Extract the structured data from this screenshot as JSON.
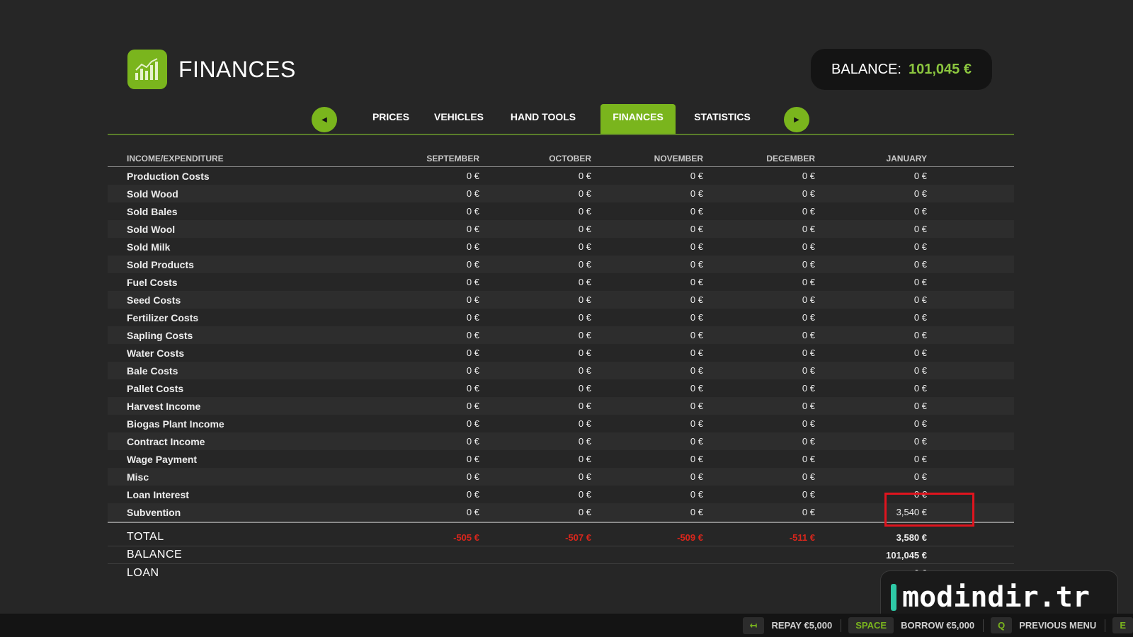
{
  "header": {
    "title": "FINANCES",
    "balance_label": "BALANCE:",
    "balance_value": "101,045 €"
  },
  "nav": {
    "prev_icon": "triangle-left",
    "next_icon": "triangle-right",
    "tabs": [
      {
        "label": "PRICES"
      },
      {
        "label": "VEHICLES"
      },
      {
        "label": "HAND TOOLS"
      },
      {
        "label": "FINANCES",
        "active": true
      },
      {
        "label": "STATISTICS"
      }
    ]
  },
  "table": {
    "headers": [
      "INCOME/EXPENDITURE",
      "SEPTEMBER",
      "OCTOBER",
      "NOVEMBER",
      "DECEMBER",
      "JANUARY"
    ],
    "rows": [
      {
        "name": "Production Costs",
        "values": [
          "0 €",
          "0 €",
          "0 €",
          "0 €",
          "0 €"
        ]
      },
      {
        "name": "Sold Wood",
        "values": [
          "0 €",
          "0 €",
          "0 €",
          "0 €",
          "0 €"
        ]
      },
      {
        "name": "Sold Bales",
        "values": [
          "0 €",
          "0 €",
          "0 €",
          "0 €",
          "0 €"
        ]
      },
      {
        "name": "Sold Wool",
        "values": [
          "0 €",
          "0 €",
          "0 €",
          "0 €",
          "0 €"
        ]
      },
      {
        "name": "Sold Milk",
        "values": [
          "0 €",
          "0 €",
          "0 €",
          "0 €",
          "0 €"
        ]
      },
      {
        "name": "Sold Products",
        "values": [
          "0 €",
          "0 €",
          "0 €",
          "0 €",
          "0 €"
        ]
      },
      {
        "name": "Fuel Costs",
        "values": [
          "0 €",
          "0 €",
          "0 €",
          "0 €",
          "0 €"
        ]
      },
      {
        "name": "Seed Costs",
        "values": [
          "0 €",
          "0 €",
          "0 €",
          "0 €",
          "0 €"
        ]
      },
      {
        "name": "Fertilizer Costs",
        "values": [
          "0 €",
          "0 €",
          "0 €",
          "0 €",
          "0 €"
        ]
      },
      {
        "name": "Sapling Costs",
        "values": [
          "0 €",
          "0 €",
          "0 €",
          "0 €",
          "0 €"
        ]
      },
      {
        "name": "Water Costs",
        "values": [
          "0 €",
          "0 €",
          "0 €",
          "0 €",
          "0 €"
        ]
      },
      {
        "name": "Bale Costs",
        "values": [
          "0 €",
          "0 €",
          "0 €",
          "0 €",
          "0 €"
        ]
      },
      {
        "name": "Pallet Costs",
        "values": [
          "0 €",
          "0 €",
          "0 €",
          "0 €",
          "0 €"
        ]
      },
      {
        "name": "Harvest Income",
        "values": [
          "0 €",
          "0 €",
          "0 €",
          "0 €",
          "0 €"
        ]
      },
      {
        "name": "Biogas Plant Income",
        "values": [
          "0 €",
          "0 €",
          "0 €",
          "0 €",
          "0 €"
        ]
      },
      {
        "name": "Contract Income",
        "values": [
          "0 €",
          "0 €",
          "0 €",
          "0 €",
          "0 €"
        ]
      },
      {
        "name": "Wage Payment",
        "values": [
          "0 €",
          "0 €",
          "0 €",
          "0 €",
          "0 €"
        ]
      },
      {
        "name": "Misc",
        "values": [
          "0 €",
          "0 €",
          "0 €",
          "0 €",
          "0 €"
        ]
      },
      {
        "name": "Loan Interest",
        "values": [
          "0 €",
          "0 €",
          "0 €",
          "0 €",
          "0 €"
        ]
      },
      {
        "name": "Subvention",
        "values": [
          "0 €",
          "0 €",
          "0 €",
          "0 €",
          "3,540 €"
        ]
      }
    ],
    "total": {
      "name": "TOTAL",
      "values": [
        "-505 €",
        "-507 €",
        "-509 €",
        "-511 €",
        "3,580 €"
      ],
      "negative": [
        true,
        true,
        true,
        true,
        false
      ]
    },
    "balance": {
      "name": "BALANCE",
      "value": "101,045 €"
    },
    "loan": {
      "name": "LOAN",
      "value": "0 €"
    }
  },
  "watermark": {
    "text": "modindir.tr"
  },
  "footer": {
    "actions": [
      {
        "key": "↤",
        "label": "REPAY €5,000"
      },
      {
        "key": "SPACE",
        "label": "BORROW €5,000"
      },
      {
        "key": "Q",
        "label": "PREVIOUS MENU"
      },
      {
        "key": "E",
        "label": ""
      }
    ]
  },
  "colors": {
    "accent": "#7ab51d",
    "negative": "#d9261c",
    "highlight": "#e0141e"
  }
}
